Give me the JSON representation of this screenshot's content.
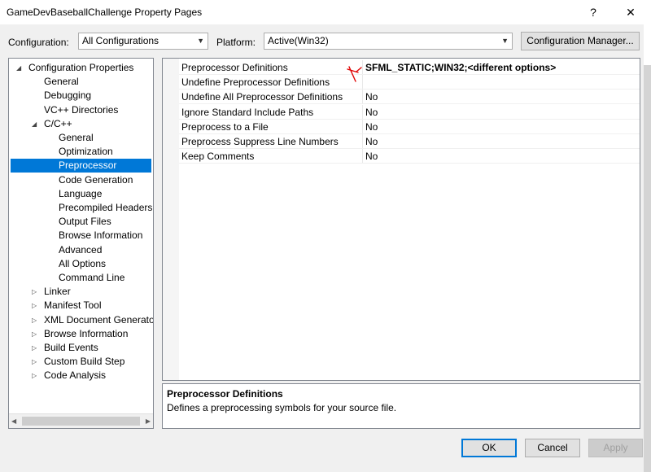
{
  "window": {
    "title": "GameDevBaseballChallenge Property Pages",
    "help_icon": "?",
    "close_icon": "✕"
  },
  "config": {
    "configuration_label": "Configuration:",
    "configuration_value": "All Configurations",
    "platform_label": "Platform:",
    "platform_value": "Active(Win32)",
    "manager_button": "Configuration Manager..."
  },
  "tree": {
    "items": [
      {
        "label": "Configuration Properties",
        "toggle": "◢"
      },
      {
        "label": "General"
      },
      {
        "label": "Debugging"
      },
      {
        "label": "VC++ Directories"
      },
      {
        "label": "C/C++",
        "toggle": "◢"
      },
      {
        "label": "General"
      },
      {
        "label": "Optimization"
      },
      {
        "label": "Preprocessor",
        "selected": true
      },
      {
        "label": "Code Generation"
      },
      {
        "label": "Language"
      },
      {
        "label": "Precompiled Headers"
      },
      {
        "label": "Output Files"
      },
      {
        "label": "Browse Information"
      },
      {
        "label": "Advanced"
      },
      {
        "label": "All Options"
      },
      {
        "label": "Command Line"
      },
      {
        "label": "Linker",
        "toggle": "▷"
      },
      {
        "label": "Manifest Tool",
        "toggle": "▷"
      },
      {
        "label": "XML Document Generator",
        "toggle": "▷"
      },
      {
        "label": "Browse Information",
        "toggle": "▷"
      },
      {
        "label": "Build Events",
        "toggle": "▷"
      },
      {
        "label": "Custom Build Step",
        "toggle": "▷"
      },
      {
        "label": "Code Analysis",
        "toggle": "▷"
      }
    ],
    "scroll_left": "◀",
    "scroll_right": "▶"
  },
  "properties": [
    {
      "name": "Preprocessor Definitions",
      "value": "SFML_STATIC;WIN32;<different options>"
    },
    {
      "name": "Undefine Preprocessor Definitions",
      "value": ""
    },
    {
      "name": "Undefine All Preprocessor Definitions",
      "value": "No"
    },
    {
      "name": "Ignore Standard Include Paths",
      "value": "No"
    },
    {
      "name": "Preprocess to a File",
      "value": "No"
    },
    {
      "name": "Preprocess Suppress Line Numbers",
      "value": "No"
    },
    {
      "name": "Keep Comments",
      "value": "No"
    }
  ],
  "description": {
    "title": "Preprocessor Definitions",
    "text": "Defines a preprocessing symbols for your source file."
  },
  "buttons": {
    "ok": "OK",
    "cancel": "Cancel",
    "apply": "Apply"
  },
  "colors": {
    "selection": "#0078d7",
    "annotation": "#e00000"
  }
}
